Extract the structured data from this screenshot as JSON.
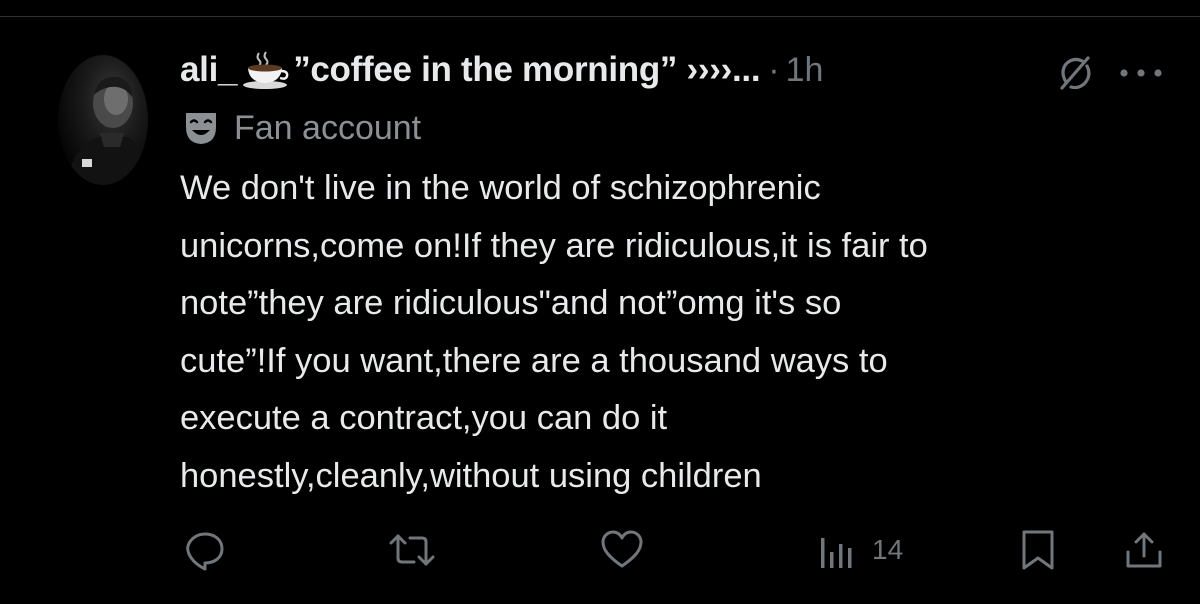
{
  "post": {
    "display_name_prefix": "ali_",
    "display_name_suffix": "”coffee in the morning” ››››...",
    "separator": "·",
    "time": "1h",
    "label": "Fan account",
    "text_lines": [
      "We don't live in the world of schizophrenic",
      "unicorns,come on!If they are ridiculous,it is fair to",
      "note”they are ridiculous\"and not”omg it's so",
      "cute”!If you want,there are a thousand ways to",
      "execute a contract,you can do it",
      "honestly,cleanly,without using children"
    ]
  },
  "actions": {
    "views_count": "14"
  },
  "icons": {
    "avatar": "avatar",
    "name_emoji": "coffee-cup-icon",
    "grok": "grok-icon",
    "more": "more-icon",
    "label": "theater-mask-icon",
    "reply": "reply-icon",
    "repost": "repost-icon",
    "like": "heart-icon",
    "views": "views-icon",
    "bookmark": "bookmark-icon",
    "share": "share-icon"
  },
  "colors": {
    "background": "#000000",
    "text": "#e7e9ea",
    "secondary": "#71767b"
  }
}
